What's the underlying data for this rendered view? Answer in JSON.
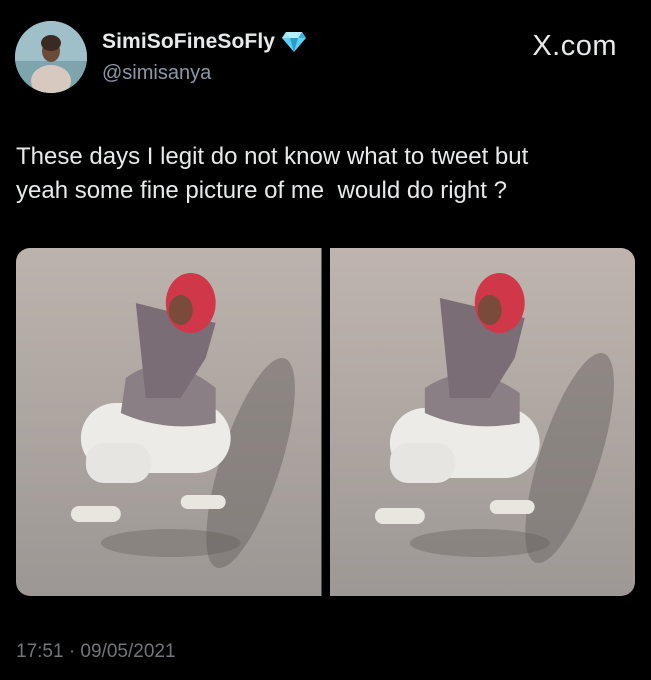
{
  "author": {
    "display_name": "SimiSoFineSoFly",
    "handle": "@simisanya",
    "verified_badge_icon": "gem-icon",
    "avatar_icon": "profile-avatar"
  },
  "brand": {
    "label": "X.com"
  },
  "tweet": {
    "text": "These days I legit do not know what to tweet but\nyeah some fine picture of me  would do right ?",
    "media": [
      {
        "name": "photo-1",
        "description_icon": "photo"
      },
      {
        "name": "photo-2",
        "description_icon": "photo"
      }
    ],
    "timestamp": "17:51 · 09/05/2021"
  },
  "colors": {
    "background": "#000000",
    "primary_text": "#e7e9ea",
    "secondary_text": "#8b98a5",
    "timestamp_text": "#71767b",
    "gem_blue": "#5fd0f5"
  }
}
